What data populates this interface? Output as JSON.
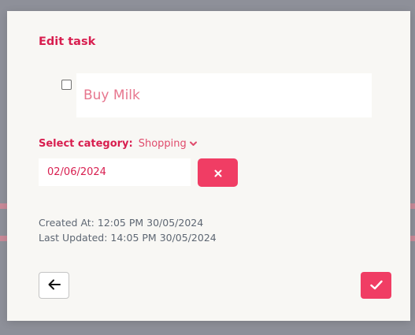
{
  "modal": {
    "title": "Edit task",
    "task": {
      "name": "Buy Milk",
      "completed": false
    },
    "category": {
      "label": "Select category:",
      "selected": "Shopping"
    },
    "due_date": "02/06/2024",
    "meta": {
      "created": "Created At: 12:05 PM 30/05/2024",
      "updated": "Last Updated: 14:05 PM 30/05/2024"
    },
    "icons": {
      "clear": "close-icon",
      "back": "arrow-left-icon",
      "save": "check-icon",
      "dropdown": "chevron-down-icon"
    },
    "colors": {
      "accent": "#d81e4f",
      "button": "#f03d64",
      "overlay": "#8e9099",
      "modal_bg": "#f8f7f4"
    }
  }
}
